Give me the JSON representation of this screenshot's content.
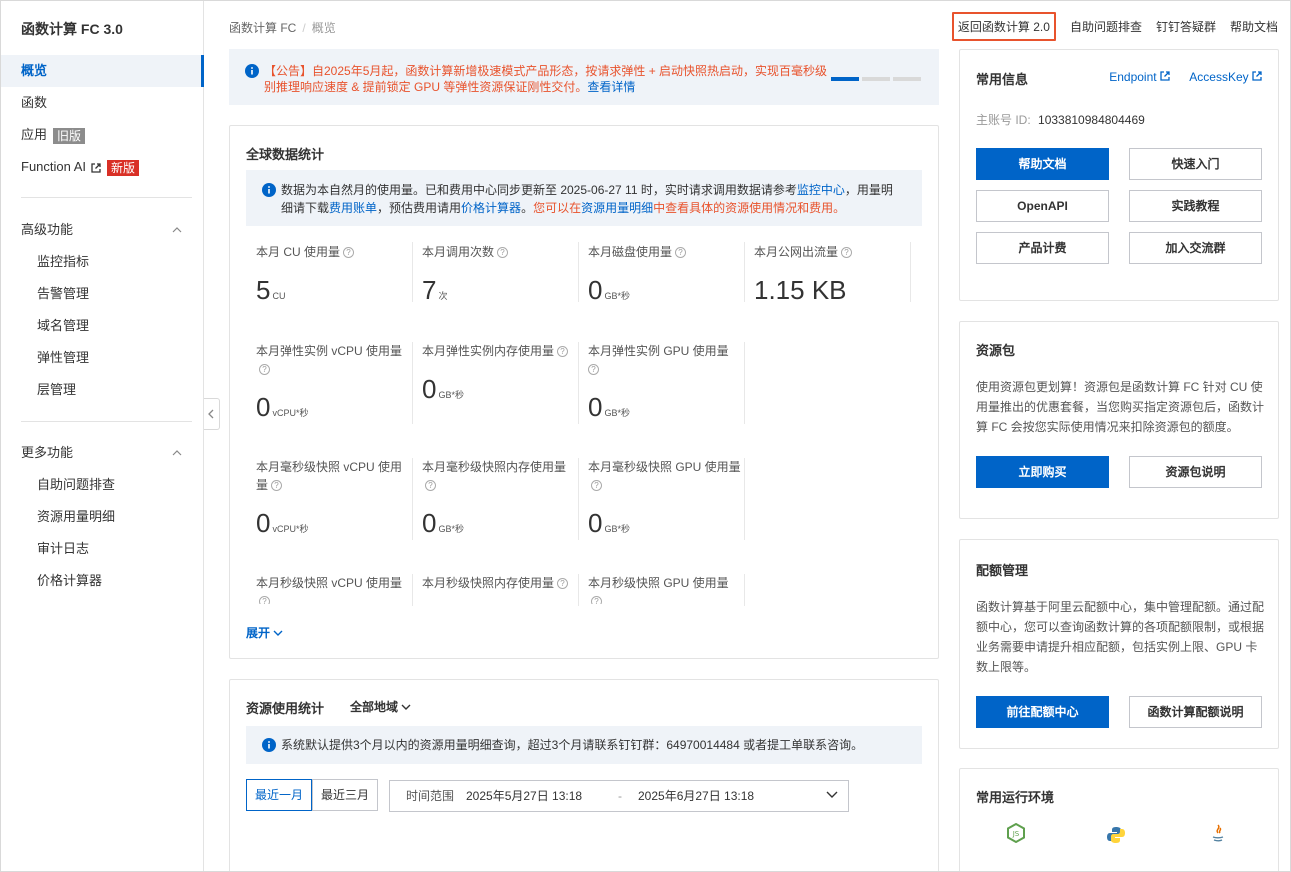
{
  "sidebar": {
    "title": "函数计算 FC 3.0",
    "items": [
      {
        "label": "概览",
        "active": true
      },
      {
        "label": "函数"
      },
      {
        "label": "应用",
        "tag": "旧版"
      },
      {
        "label": "Function AI",
        "tag": "新版"
      }
    ],
    "advanced": {
      "label": "高级功能",
      "items": [
        "监控指标",
        "告警管理",
        "域名管理",
        "弹性管理",
        "层管理"
      ]
    },
    "more": {
      "label": "更多功能",
      "items": [
        "自助问题排查",
        "资源用量明细",
        "审计日志",
        "价格计算器"
      ]
    }
  },
  "breadcrumb": {
    "root": "函数计算 FC",
    "sep": "/",
    "current": "概览"
  },
  "top_links": {
    "back": "返回函数计算 2.0",
    "troubleshoot": "自助问题排查",
    "dingtalk": "钉钉答疑群",
    "help": "帮助文档"
  },
  "notice": {
    "text": "【公告】自2025年5月起，函数计算新增极速模式产品形态，按请求弹性 + 启动快照热启动，实现百毫秒级别推理响应速度 & 提前锁定 GPU 等弹性资源保证刚性交付。",
    "link": "查看详情"
  },
  "global_stats": {
    "title": "全球数据统计",
    "info": {
      "p1": "数据为本自然月的使用量。已和费用中心同步更新至 2025-06-27 11 时，实时请求调用数据请参考",
      "link1": "监控中心",
      "p2": "，用量明细请下载",
      "link2": "费用账单",
      "p3": "，预估费用请用",
      "link3": "价格计算器",
      "p4": "。",
      "orange1": "您可以在",
      "link4": "资源用量明细",
      "orange2": "中查看具体的资源使用情况和费用。"
    },
    "row1": [
      {
        "label": "本月 CU 使用量",
        "value": "5",
        "unit": "CU"
      },
      {
        "label": "本月调用次数",
        "value": "7",
        "unit": "次"
      },
      {
        "label": "本月磁盘使用量",
        "value": "0",
        "unit": "GB*秒"
      },
      {
        "label": "本月公网出流量",
        "value": "1.15 KB",
        "unit": ""
      }
    ],
    "row2": [
      {
        "label": "本月弹性实例 vCPU 使用量",
        "value": "0",
        "unit": "vCPU*秒"
      },
      {
        "label": "本月弹性实例内存使用量",
        "value": "0",
        "unit": "GB*秒"
      },
      {
        "label": "本月弹性实例 GPU 使用量",
        "value": "0",
        "unit": "GB*秒"
      }
    ],
    "row3": [
      {
        "label": "本月毫秒级快照 vCPU 使用量",
        "value": "0",
        "unit": "vCPU*秒"
      },
      {
        "label": "本月毫秒级快照内存使用量",
        "value": "0",
        "unit": "GB*秒"
      },
      {
        "label": "本月毫秒级快照 GPU 使用量",
        "value": "0",
        "unit": "GB*秒"
      }
    ],
    "row4": [
      {
        "label": "本月秒级快照 vCPU 使用量"
      },
      {
        "label": "本月秒级快照内存使用量"
      },
      {
        "label": "本月秒级快照 GPU 使用量"
      }
    ],
    "expand": "展开"
  },
  "resource_stats": {
    "title": "资源使用统计",
    "region": "全部地域",
    "info": "系统默认提供3个月以内的资源用量明细查询，超过3个月请联系钉钉群：64970014484 或者提工单联系咨询。",
    "seg_month": "最近一月",
    "seg_quarter": "最近三月",
    "range_label": "时间范围",
    "range_start": "2025年5月27日 13:18",
    "range_sep": "-",
    "range_end": "2025年6月27日 13:18"
  },
  "common_info": {
    "title": "常用信息",
    "endpoint": "Endpoint",
    "accesskey": "AccessKey",
    "account_label": "主账号 ID:",
    "account_id": "1033810984804469",
    "buttons": [
      "帮助文档",
      "快速入门",
      "OpenAPI",
      "实践教程",
      "产品计费",
      "加入交流群"
    ]
  },
  "resource_pack": {
    "title": "资源包",
    "text": "使用资源包更划算！资源包是函数计算 FC 针对 CU 使用量推出的优惠套餐，当您购买指定资源包后，函数计算 FC 会按您实际使用情况来扣除资源包的额度。",
    "buy": "立即购买",
    "desc": "资源包说明"
  },
  "quota": {
    "title": "配额管理",
    "text": "函数计算基于阿里云配额中心，集中管理配额。通过配额中心，您可以查询函数计算的各项配额限制，或根据业务需要申请提升相应配额，包括实例上限、GPU 卡数上限等。",
    "go": "前往配额中心",
    "desc": "函数计算配额说明"
  },
  "runtime": {
    "title": "常用运行环境"
  },
  "colors": {
    "primary": "#0064c8",
    "orange": "#e8532d",
    "red_tag": "#d93026"
  }
}
